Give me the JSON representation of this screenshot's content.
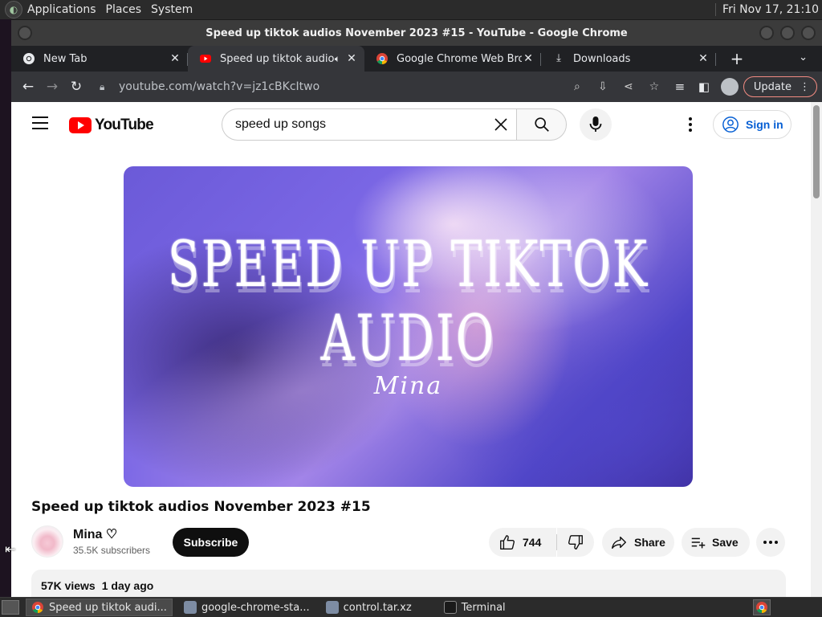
{
  "top_panel": {
    "menus": [
      "Applications",
      "Places",
      "System"
    ],
    "clock": "Fri Nov 17, 21:10"
  },
  "window": {
    "title": "Speed up tiktok audios November 2023 #15 - YouTube - Google Chrome"
  },
  "tabs": [
    {
      "label": "New Tab",
      "icon": "chrome-icon",
      "active": false
    },
    {
      "label": "Speed up tiktok audios",
      "icon": "youtube-icon",
      "active": true,
      "audio": true
    },
    {
      "label": "Google Chrome Web Brow",
      "icon": "chrome-icon",
      "active": false
    },
    {
      "label": "Downloads",
      "icon": "download-icon",
      "active": false
    }
  ],
  "toolbar": {
    "url": "youtube.com/watch?v=jz1cBKcItwo",
    "update_label": "Update"
  },
  "youtube": {
    "logo_text": "YouTube",
    "search_value": "speed up songs",
    "sign_in_label": "Sign in",
    "video_art_title": "SPEED UP TIKTOK AUDIO",
    "video_art_artist": "Mina",
    "video_title": "Speed up tiktok audios November 2023 #15",
    "channel_name": "Mina ♡",
    "subscribers": "35.5K subscribers",
    "subscribe_label": "Subscribe",
    "likes": "744",
    "share_label": "Share",
    "save_label": "Save",
    "views": "57K views",
    "uploaded": "1 day ago"
  },
  "taskbar": {
    "items": [
      {
        "label": "Speed up tiktok audi...",
        "icon": "chrome-icon",
        "active": true
      },
      {
        "label": "google-chrome-sta...",
        "icon": "archive-icon",
        "active": false
      },
      {
        "label": "control.tar.xz",
        "icon": "archive-icon",
        "active": false
      },
      {
        "label": "Terminal",
        "icon": "terminal-icon",
        "active": false
      }
    ]
  },
  "colors": {
    "youtube_red": "#ff0000",
    "sign_in_blue": "#065fd4",
    "chrome_dark": "#35363a",
    "update_border": "#f28b82"
  }
}
